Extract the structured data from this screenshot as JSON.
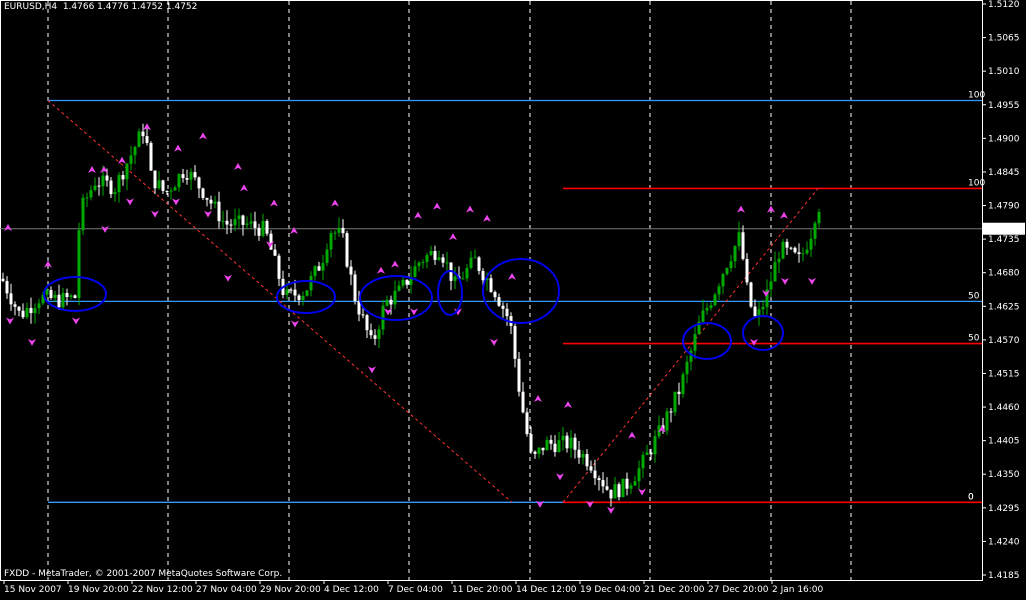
{
  "header": {
    "symbol_info": "EURUSD,H4  1.4766 1.4776 1.4752 1.4752"
  },
  "footer": {
    "copyright": "FXDD - MetaTrader, © 2001-2007 MetaQuotes Software Corp."
  },
  "chart_data": {
    "type": "candlestick",
    "symbol": "EURUSD",
    "timeframe": "H4",
    "ohlc_header": {
      "open": 1.4766,
      "high": 1.4776,
      "low": 1.4752,
      "close": 1.4752
    },
    "current_price": "1.4752",
    "y_ticks": [
      "1.5120",
      "1.5065",
      "1.5010",
      "1.4955",
      "1.4900",
      "1.4845",
      "1.4790",
      "1.4735",
      "1.4680",
      "1.4625",
      "1.4570",
      "1.4515",
      "1.4460",
      "1.4405",
      "1.4350",
      "1.4295",
      "1.4240",
      "1.4185"
    ],
    "ylim": [
      1.4185,
      1.512
    ],
    "x_ticks": [
      "15 Nov 2007",
      "19 Nov 20:00",
      "22 Nov 12:00",
      "27 Nov 04:00",
      "29 Nov 20:00",
      "4 Dec 12:00",
      "7 Dec 04:00",
      "11 Dec 20:00",
      "14 Dec 12:00",
      "19 Dec 04:00",
      "21 Dec 20:00",
      "27 Dec 20:00",
      "2 Jan 16:00"
    ],
    "grid": "vertical-dashed",
    "fibo_blue": {
      "levels": [
        {
          "label": "100",
          "price": 1.4962
        },
        {
          "label": "50",
          "price": 1.4633
        },
        {
          "label": "0",
          "price": 1.4304
        }
      ]
    },
    "fibo_red": {
      "levels": [
        {
          "label": "100",
          "price": 1.4818
        },
        {
          "label": "50",
          "price": 1.4564
        },
        {
          "label": "0",
          "price": 1.4304
        }
      ]
    },
    "colors": {
      "background": "#000000",
      "bull": "#00aa00",
      "bear": "#ffffff",
      "fibo_blue": "#3399ff",
      "fibo_red": "#ff0000",
      "fractal": "#ee44ee",
      "ellipse": "#0000ee",
      "grid": "#ffffff",
      "price_label_bg": "#ffffff"
    },
    "annotations": "blue ellipses highlighting retests of the 50% levels; magenta fractal arrows above/below swing bars"
  }
}
